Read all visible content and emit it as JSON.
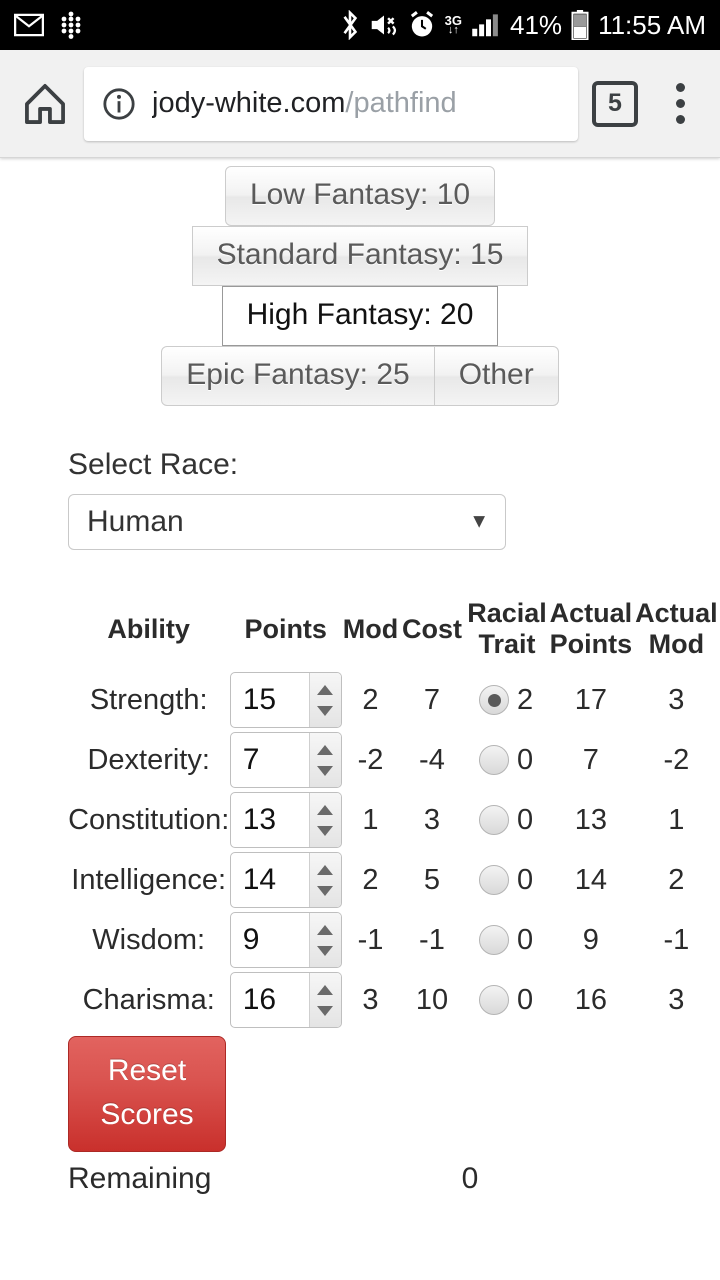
{
  "statusbar": {
    "left_icons": [
      "gmail-icon",
      "app-dots-icon"
    ],
    "right_icons": [
      "bluetooth-icon",
      "mute-icon",
      "alarm-icon",
      "3g-icon",
      "signal-icon",
      "battery-icon"
    ],
    "network_label": "3G",
    "battery_percent": "41%",
    "clock": "11:55 AM"
  },
  "browser": {
    "home_icon": "home-icon",
    "site_info_icon": "info-circle-icon",
    "url_host": "jody-white.com",
    "url_path": "/pathfind",
    "tab_count": "5",
    "menu_icon": "overflow-menu-icon"
  },
  "fantasy_levels": {
    "buttons": [
      {
        "label": "Low Fantasy: 10",
        "selected": false
      },
      {
        "label": "Standard Fantasy: 15",
        "selected": false
      },
      {
        "label": "High Fantasy: 20",
        "selected": true
      },
      {
        "label": "Epic Fantasy: 25",
        "selected": false
      },
      {
        "label": "Other",
        "selected": false
      }
    ]
  },
  "race": {
    "label": "Select Race:",
    "selected": "Human",
    "caret": "▼"
  },
  "table": {
    "headers": {
      "ability": "Ability",
      "points": "Points",
      "mod": "Mod",
      "cost": "Cost",
      "trait_line1": "Racial",
      "trait_line2": "Trait",
      "actual_points_line1": "Actual",
      "actual_points_line2": "Points",
      "actual_mod_line1": "Actual",
      "actual_mod_line2": "Mod"
    },
    "rows": [
      {
        "ability": "Strength:",
        "points": "15",
        "mod": "2",
        "cost": "7",
        "trait": "2",
        "trait_selected": true,
        "actual_points": "17",
        "actual_mod": "3"
      },
      {
        "ability": "Dexterity:",
        "points": "7",
        "mod": "-2",
        "cost": "-4",
        "trait": "0",
        "trait_selected": false,
        "actual_points": "7",
        "actual_mod": "-2"
      },
      {
        "ability": "Constitution:",
        "points": "13",
        "mod": "1",
        "cost": "3",
        "trait": "0",
        "trait_selected": false,
        "actual_points": "13",
        "actual_mod": "1"
      },
      {
        "ability": "Intelligence:",
        "points": "14",
        "mod": "2",
        "cost": "5",
        "trait": "0",
        "trait_selected": false,
        "actual_points": "14",
        "actual_mod": "2"
      },
      {
        "ability": "Wisdom:",
        "points": "9",
        "mod": "-1",
        "cost": "-1",
        "trait": "0",
        "trait_selected": false,
        "actual_points": "9",
        "actual_mod": "-1"
      },
      {
        "ability": "Charisma:",
        "points": "16",
        "mod": "3",
        "cost": "10",
        "trait": "0",
        "trait_selected": false,
        "actual_points": "16",
        "actual_mod": "3"
      }
    ]
  },
  "footer": {
    "reset_line1": "Reset",
    "reset_line2": "Scores",
    "remaining_label": "Remaining",
    "remaining_value": "0"
  },
  "colors": {
    "link_blue": "#1a8ccc",
    "danger_red": "#d9534f",
    "toolbar_bg": "#f1f1f1"
  }
}
